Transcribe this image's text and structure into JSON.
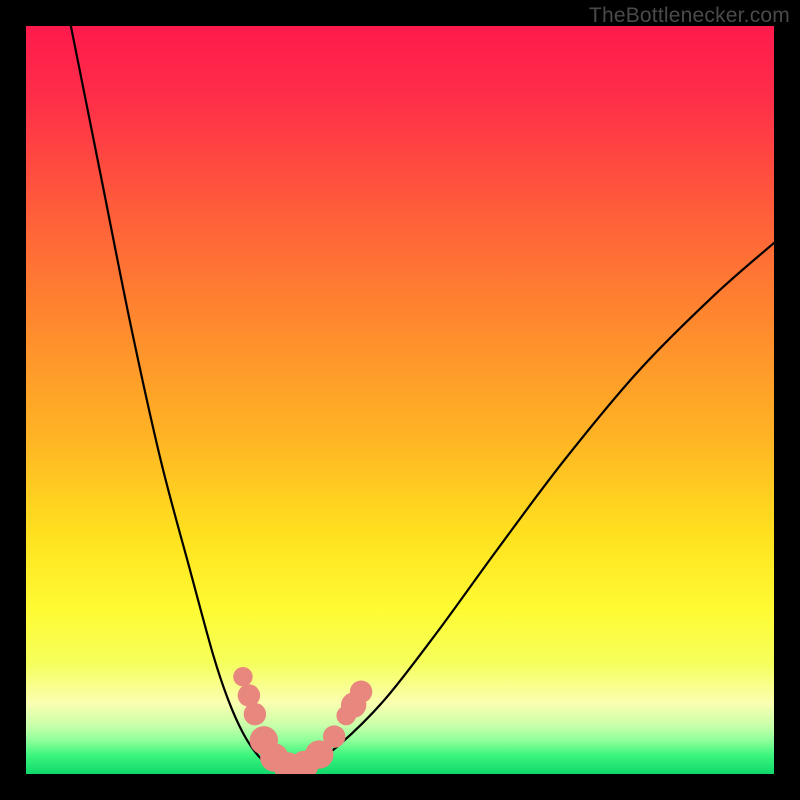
{
  "watermark": "TheBottlenecker.com",
  "gradient": {
    "stops": [
      {
        "offset": 0.0,
        "color": "#ff1a4d"
      },
      {
        "offset": 0.1,
        "color": "#ff2f48"
      },
      {
        "offset": 0.25,
        "color": "#ff5e3a"
      },
      {
        "offset": 0.4,
        "color": "#ff8a2e"
      },
      {
        "offset": 0.55,
        "color": "#ffb424"
      },
      {
        "offset": 0.68,
        "color": "#ffe11e"
      },
      {
        "offset": 0.78,
        "color": "#fffb33"
      },
      {
        "offset": 0.85,
        "color": "#f6ff5a"
      },
      {
        "offset": 0.905,
        "color": "#faffb0"
      },
      {
        "offset": 0.935,
        "color": "#c9ffaa"
      },
      {
        "offset": 0.955,
        "color": "#8fff9a"
      },
      {
        "offset": 0.975,
        "color": "#3cf57e"
      },
      {
        "offset": 1.0,
        "color": "#0fd86a"
      }
    ]
  },
  "curve_color": "#000000",
  "marker_color": "#e8877d",
  "chart_data": {
    "type": "line",
    "title": "",
    "xlabel": "",
    "ylabel": "",
    "xlim": [
      0,
      100
    ],
    "ylim": [
      0,
      100
    ],
    "series": [
      {
        "name": "bottleneck-curve-left",
        "x": [
          6,
          10,
          14,
          18,
          22,
          25,
          27,
          29,
          31,
          33,
          35
        ],
        "y": [
          100,
          80,
          60,
          42,
          27,
          16,
          10,
          5.5,
          2.5,
          0.8,
          0
        ]
      },
      {
        "name": "bottleneck-curve-right",
        "x": [
          35,
          38,
          42,
          48,
          55,
          63,
          72,
          82,
          92,
          100
        ],
        "y": [
          0,
          1.2,
          4,
          10,
          19,
          30,
          42,
          54,
          64,
          71
        ]
      }
    ],
    "markers": {
      "name": "highlight-points",
      "points": [
        {
          "x": 29.0,
          "y": 13.0,
          "r": 1.3
        },
        {
          "x": 29.8,
          "y": 10.5,
          "r": 1.5
        },
        {
          "x": 30.6,
          "y": 8.0,
          "r": 1.5
        },
        {
          "x": 31.8,
          "y": 4.5,
          "r": 1.9
        },
        {
          "x": 33.2,
          "y": 2.2,
          "r": 1.9
        },
        {
          "x": 35.0,
          "y": 1.0,
          "r": 1.9
        },
        {
          "x": 37.2,
          "y": 1.2,
          "r": 1.9
        },
        {
          "x": 39.2,
          "y": 2.6,
          "r": 1.9
        },
        {
          "x": 41.2,
          "y": 5.0,
          "r": 1.5
        },
        {
          "x": 42.8,
          "y": 7.8,
          "r": 1.3
        },
        {
          "x": 43.8,
          "y": 9.2,
          "r": 1.7
        },
        {
          "x": 44.8,
          "y": 11.0,
          "r": 1.5
        }
      ]
    }
  }
}
